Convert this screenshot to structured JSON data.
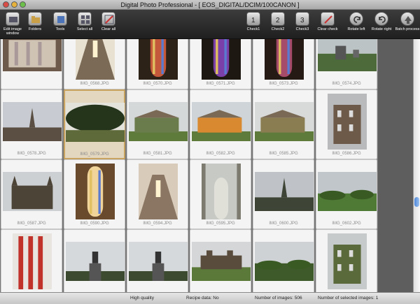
{
  "window": {
    "title": "Digital Photo Professional - [ EOS_DIGITAL/DCIM/100CANON ]"
  },
  "toolbar": {
    "left": [
      {
        "label": "Edit image window",
        "icon": "edit-image-window-icon"
      },
      {
        "label": "Folders",
        "icon": "folders-icon"
      },
      {
        "label": "Tools",
        "icon": "tools-icon"
      },
      {
        "label": "Select all",
        "icon": "select-all-icon"
      },
      {
        "label": "Clear all",
        "icon": "clear-all-icon"
      }
    ],
    "right": [
      {
        "label": "Check1",
        "icon": "check1-icon"
      },
      {
        "label": "Check2",
        "icon": "check2-icon"
      },
      {
        "label": "Check3",
        "icon": "check3-icon"
      },
      {
        "label": "Clear check",
        "icon": "clear-check-icon"
      },
      {
        "label": "Rotate left",
        "icon": "rotate-left-icon"
      },
      {
        "label": "Rotate right",
        "icon": "rotate-right-icon"
      },
      {
        "label": "Batch process",
        "icon": "batch-process-icon"
      }
    ]
  },
  "thumbnails": [
    {
      "name": "",
      "scene": "organ",
      "c1": "#6d5a4a",
      "c2": "#cfc3b3"
    },
    {
      "name": "IMG_0568.JPG",
      "scene": "nave",
      "c1": "#7b6a55",
      "c2": "#e8e0d0"
    },
    {
      "name": "IMG_0570.JPG",
      "scene": "window",
      "c1": "#2d2218",
      "c2": "#c4583a"
    },
    {
      "name": "IMG_0571.JPG",
      "scene": "window",
      "c1": "#1e1812",
      "c2": "#7a3fa8"
    },
    {
      "name": "IMG_0573.JPG",
      "scene": "window",
      "c1": "#251a14",
      "c2": "#a74b6a"
    },
    {
      "name": "IMG_0574.JPG",
      "scene": "graves",
      "c1": "#bcc3c4",
      "c2": "#4c6a3a"
    },
    {
      "name": "IMG_0578.JPG",
      "scene": "spire",
      "c1": "#c8ccd2",
      "c2": "#5a4f42"
    },
    {
      "name": "IMG_0579.JPG",
      "scene": "tree",
      "c1": "#e3e3dc",
      "c2": "#25351c"
    },
    {
      "name": "IMG_0581.JPG",
      "scene": "church",
      "c1": "#d5d8d8",
      "c2": "#6b7c4c"
    },
    {
      "name": "IMG_0582.JPG",
      "scene": "church",
      "c1": "#cfd4d8",
      "c2": "#d98a30"
    },
    {
      "name": "IMG_0585.JPG",
      "scene": "church",
      "c1": "#d7dad8",
      "c2": "#8a7d52"
    },
    {
      "name": "IMG_0586.JPG",
      "scene": "house",
      "c1": "#b8babb",
      "c2": "#6e5a48"
    },
    {
      "name": "IMG_0587.JPG",
      "scene": "cathedral",
      "c1": "#cdd0d2",
      "c2": "#4d4438"
    },
    {
      "name": "IMG_0590.JPG",
      "scene": "window",
      "c1": "#6a4a2c",
      "c2": "#f0d49a"
    },
    {
      "name": "IMG_0594.JPG",
      "scene": "nave",
      "c1": "#8a7662",
      "c2": "#d8cbb9"
    },
    {
      "name": "IMG_0595.JPG",
      "scene": "arch",
      "c1": "#7d7a70",
      "c2": "#c7c9c4"
    },
    {
      "name": "IMG_0600.JPG",
      "scene": "spire",
      "c1": "#bfc3c7",
      "c2": "#3f4536"
    },
    {
      "name": "IMG_0602.JPG",
      "scene": "park",
      "c1": "#c1c6ca",
      "c2": "#4f7a36"
    },
    {
      "name": "",
      "scene": "columns",
      "c1": "#e8e4e0",
      "c2": "#c0322a"
    },
    {
      "name": "",
      "scene": "statue",
      "c1": "#d6d9dc",
      "c2": "#3c4a30"
    },
    {
      "name": "",
      "scene": "statue",
      "c1": "#d6d9dc",
      "c2": "#3c4a30"
    },
    {
      "name": "",
      "scene": "castle",
      "c1": "#d4d6d8",
      "c2": "#5a4c3c"
    },
    {
      "name": "",
      "scene": "park",
      "c1": "#cfd2d4",
      "c2": "#3f5a2a"
    },
    {
      "name": "",
      "scene": "house",
      "c1": "#c6cacb",
      "c2": "#5a6a3a"
    }
  ],
  "selected_index": 7,
  "status": {
    "quality": "High quality",
    "recipe": "Recipe data: No",
    "count": "Number of images: 506",
    "selected": "Number of selected images: 1"
  }
}
